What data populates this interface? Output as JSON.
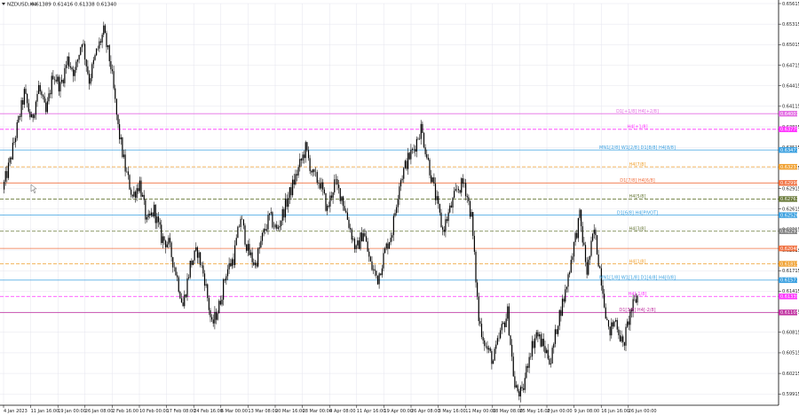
{
  "header": {
    "symbol_text": "NZDUSD,H4",
    "ohlc_text": "0.61389 0.61416 0.61338 0.61340"
  },
  "chart_data": {
    "type": "line",
    "title": "NZDUSD,H4",
    "ylim": [
      0.59815,
      0.65615
    ],
    "price_ticks": [
      "0.65615",
      "0.65315",
      "0.65015",
      "0.64715",
      "0.64415",
      "0.64115",
      "0.63815",
      "0.63515",
      "0.63215",
      "0.62915",
      "0.62615",
      "0.62315",
      "0.62015",
      "0.61715",
      "0.61415",
      "0.61115",
      "0.60815",
      "0.60515",
      "0.60215",
      "0.59915"
    ],
    "date_ticks": [
      "4 Jan 2023",
      "11 Jan 16:00",
      "19 Jan 00:00",
      "26 Jan 08:00",
      "2 Feb 16:00",
      "10 Feb 00:00",
      "17 Feb 08:00",
      "24 Feb 16:00",
      "6 Mar 00:00",
      "13 Mar 08:00",
      "20 Mar 16:00",
      "28 Mar 00:00",
      "4 Apr 08:00",
      "11 Apr 16:00",
      "19 Apr 00:00",
      "26 Apr 08:00",
      "3 May 16:00",
      "11 May 00:00",
      "18 May 08:00",
      "25 May 16:00",
      "2 Jun 00:00",
      "9 Jun 08:00",
      "16 Jun 16:00",
      "26 Jun 00:00"
    ],
    "levels": [
      {
        "price": 0.64007,
        "label": "D1[+1/8] H4[+2/8]",
        "color": "#e36ee3",
        "dash": false
      },
      {
        "price": 0.63779,
        "label": "H4[+1/8]",
        "color": "#ff33ff",
        "dash": true
      },
      {
        "price": 0.63477,
        "label": "MN1[2/8] W1[2/8] D1[8/8] H4[8/8]",
        "color": "#3aa0e0",
        "dash": false
      },
      {
        "price": 0.63231,
        "label": "H4[7/8]",
        "color": "#f0a030",
        "dash": true
      },
      {
        "price": 0.62996,
        "label": "D1[7/8] H4[6/8]",
        "color": "#f07040",
        "dash": false
      },
      {
        "price": 0.62761,
        "label": "H4[5/8]",
        "color": "#6a7a3a",
        "dash": true
      },
      {
        "price": 0.62526,
        "label": "D1[6/8] H4[PIVOT]",
        "color": "#3aa0e0",
        "dash": false
      },
      {
        "price": 0.62291,
        "label": "H4[3/8]",
        "color": "#6a7a3a",
        "dash": true
      },
      {
        "price": 0.6204,
        "label": "",
        "color": "#f07040",
        "dash": false
      },
      {
        "price": 0.61815,
        "label": "H4[1/8]",
        "color": "#f0a030",
        "dash": true
      },
      {
        "price": 0.61577,
        "label": "MN1[1/8] W1[1/8] D1[4/8] H4[0/8]",
        "color": "#3aa0e0",
        "dash": false
      },
      {
        "price": 0.61339,
        "label": "H4[-1/8]",
        "color": "#ff33ff",
        "dash": true
      },
      {
        "price": 0.61105,
        "label": "D1[3/8] H4[-2/8]",
        "color": "#c030a0",
        "dash": false
      }
    ],
    "price_tags": [
      {
        "text": "0.64007",
        "color": "#e36ee3"
      },
      {
        "text": "0.63779",
        "color": "#ff33ff"
      },
      {
        "text": "0.63477",
        "color": "#3aa0e0"
      },
      {
        "text": "0.63231",
        "color": "#f0a030"
      },
      {
        "text": "0.62996",
        "color": "#f07040"
      },
      {
        "text": "0.62761",
        "color": "#6a7a3a"
      },
      {
        "text": "0.62526",
        "color": "#3aa0e0"
      },
      {
        "text": "0.62291",
        "color": "#808080"
      },
      {
        "text": "0.62040",
        "color": "#f07040"
      },
      {
        "text": "0.61815",
        "color": "#f0a030"
      },
      {
        "text": "0.61577",
        "color": "#3aa0e0"
      },
      {
        "text": "0.61339",
        "color": "#ff33ff"
      },
      {
        "text": "0.61105",
        "color": "#c030a0"
      }
    ],
    "series": [
      {
        "x": [
          "4 Jan",
          "6 Jan",
          "9 Jan",
          "11 Jan",
          "13 Jan",
          "16 Jan",
          "18 Jan",
          "19 Jan",
          "20 Jan",
          "23 Jan",
          "25 Jan",
          "26 Jan",
          "27 Jan",
          "30 Jan",
          "1 Feb",
          "2 Feb",
          "3 Feb",
          "6 Feb",
          "8 Feb",
          "10 Feb",
          "13 Feb",
          "15 Feb",
          "17 Feb",
          "20 Feb",
          "22 Feb",
          "24 Feb",
          "27 Feb",
          "1 Mar",
          "3 Mar",
          "6 Mar",
          "8 Mar",
          "10 Mar",
          "13 Mar",
          "15 Mar",
          "17 Mar",
          "20 Mar",
          "22 Mar",
          "24 Mar",
          "27 Mar",
          "29 Mar",
          "31 Mar",
          "3 Apr",
          "4 Apr",
          "5 Apr",
          "7 Apr",
          "10 Apr",
          "12 Apr",
          "14 Apr",
          "17 Apr",
          "19 Apr",
          "21 Apr",
          "24 Apr",
          "26 Apr",
          "28 Apr",
          "1 May",
          "3 May",
          "4 May",
          "5 May",
          "8 May",
          "10 May",
          "11 May",
          "12 May",
          "15 May",
          "17 May",
          "18 May",
          "19 May",
          "22 May",
          "24 May",
          "25 May",
          "26 May",
          "29 May",
          "31 May",
          "1 Jun",
          "2 Jun",
          "5 Jun",
          "7 Jun",
          "9 Jun",
          "12 Jun",
          "14 Jun",
          "16 Jun",
          "19 Jun",
          "21 Jun",
          "23 Jun",
          "26 Jun",
          "27 Jun",
          "28 Jun",
          "29 Jun",
          "30 Jun",
          "3 Jul"
        ],
        "y": [
          0.629,
          0.633,
          0.638,
          0.643,
          0.639,
          0.644,
          0.64,
          0.646,
          0.644,
          0.648,
          0.646,
          0.651,
          0.645,
          0.649,
          0.652,
          0.647,
          0.638,
          0.632,
          0.628,
          0.63,
          0.624,
          0.626,
          0.622,
          0.621,
          0.617,
          0.612,
          0.618,
          0.62,
          0.616,
          0.609,
          0.612,
          0.617,
          0.619,
          0.625,
          0.62,
          0.618,
          0.622,
          0.625,
          0.623,
          0.626,
          0.629,
          0.632,
          0.635,
          0.631,
          0.63,
          0.626,
          0.63,
          0.628,
          0.624,
          0.62,
          0.623,
          0.618,
          0.616,
          0.62,
          0.623,
          0.63,
          0.633,
          0.635,
          0.638,
          0.633,
          0.628,
          0.623,
          0.626,
          0.629,
          0.63,
          0.625,
          0.61,
          0.606,
          0.604,
          0.608,
          0.611,
          0.6,
          0.599,
          0.605,
          0.608,
          0.606,
          0.604,
          0.61,
          0.614,
          0.62,
          0.625,
          0.617,
          0.623,
          0.616,
          0.608,
          0.61,
          0.606,
          0.611,
          0.6134
        ]
      }
    ]
  }
}
